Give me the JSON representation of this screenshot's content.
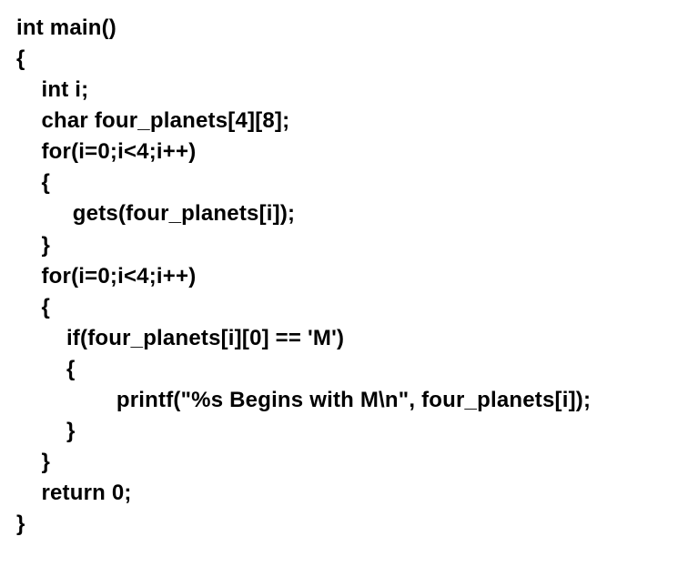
{
  "code": {
    "line01": "int main()",
    "line02": "{",
    "line03": "    int i;",
    "line04": "    char four_planets[4][8];",
    "line05": "    for(i=0;i<4;i++)",
    "line06": "    {",
    "line07": "         gets(four_planets[i]);",
    "line08": "    }",
    "line09": "    for(i=0;i<4;i++)",
    "line10": "    {",
    "line11": "        if(four_planets[i][0] == 'M')",
    "line12": "        {",
    "line13": "                printf(\"%s Begins with M\\n\", four_planets[i]);",
    "line14": "        }",
    "line15": "    }",
    "line16": "    return 0;",
    "line17": "}"
  }
}
